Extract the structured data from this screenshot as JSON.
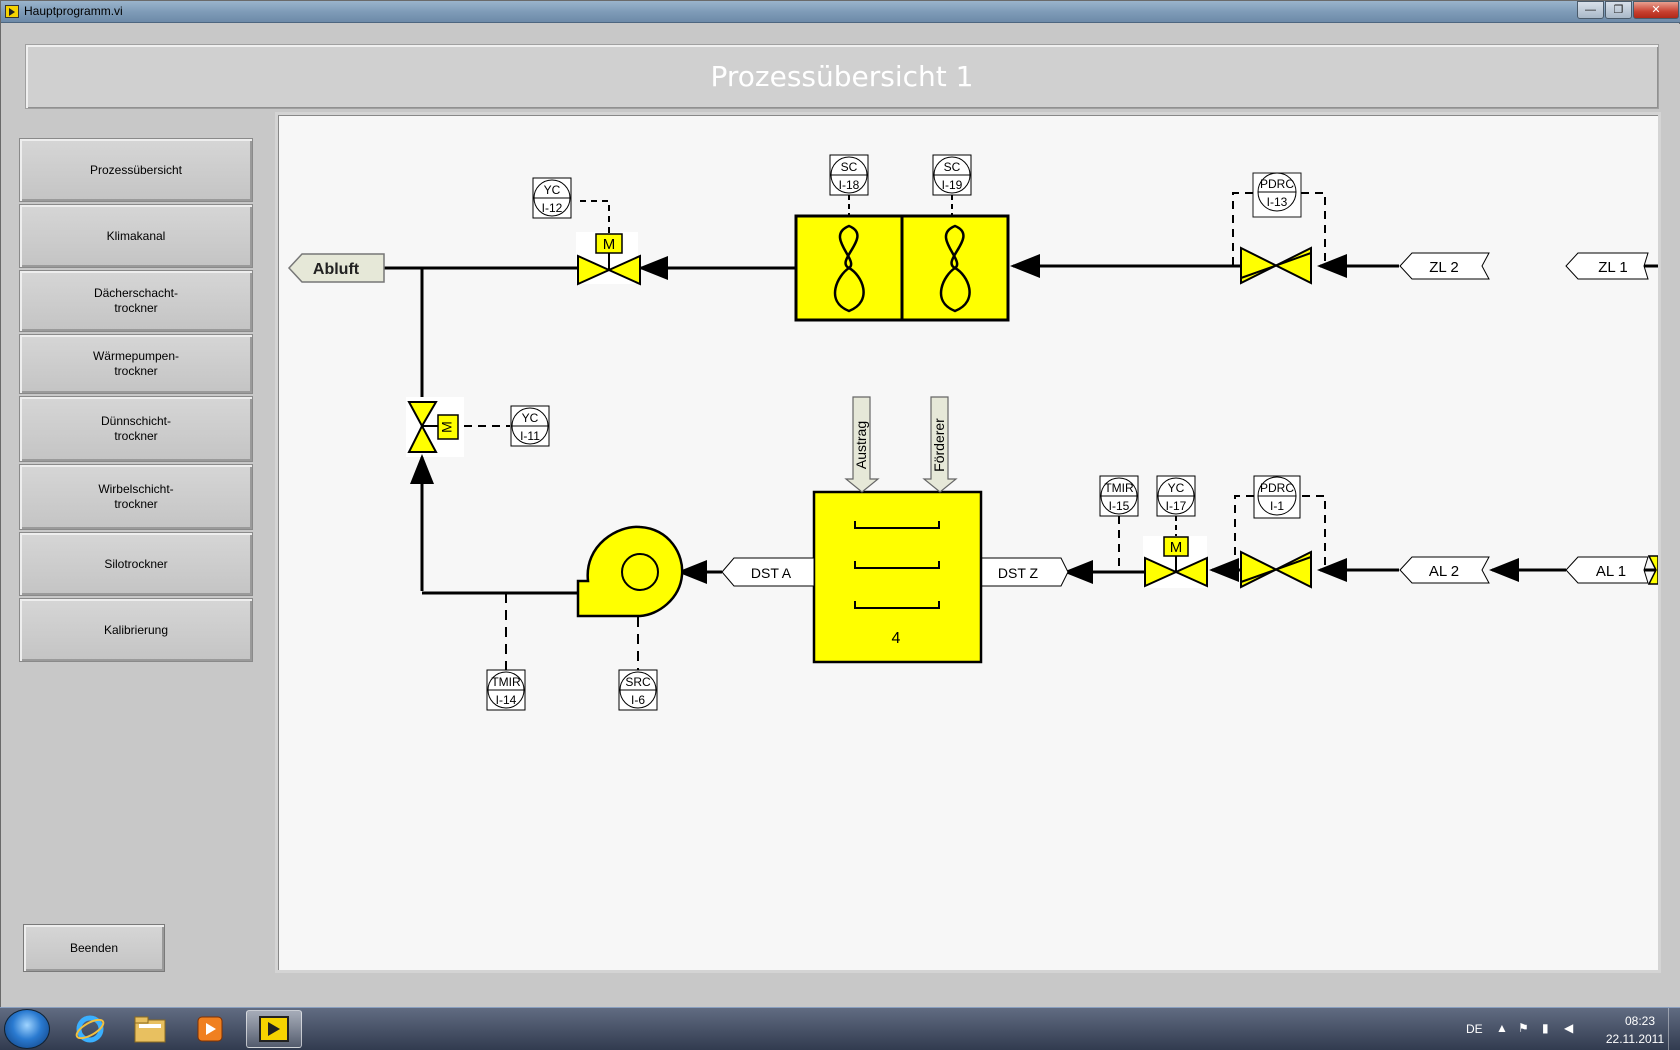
{
  "window": {
    "title": "Hauptprogramm.vi",
    "minimize": "—",
    "maximize": "❐",
    "close": "✕"
  },
  "header": {
    "title": "Prozessübersicht 1"
  },
  "sidebar": {
    "items": [
      {
        "label": "Prozessübersicht"
      },
      {
        "label": "Klimakanal"
      },
      {
        "label": "Dächerschacht-\ntrockner"
      },
      {
        "label": "Wärmepumpen-\ntrockner"
      },
      {
        "label": "Dünnschicht-\ntrockner"
      },
      {
        "label": "Wirbelschicht-\ntrockner"
      },
      {
        "label": "Silotrockner"
      },
      {
        "label": "Kalibrierung"
      }
    ],
    "exit_label": "Beenden"
  },
  "diagram": {
    "colors": {
      "equipment": "#ffff00",
      "line": "#000000",
      "background": "#f7f7f7"
    },
    "connectors": {
      "abluft": "Abluft",
      "zl2": "ZL 2",
      "zl1": "ZL 1",
      "al2": "AL 2",
      "al1": "AL 1",
      "dst_a": "DST A",
      "dst_z": "DST Z"
    },
    "feeds": {
      "austrag": "Austrag",
      "foerderer": "Förderer"
    },
    "dryer_number": "4",
    "motor_label": "M",
    "instruments": [
      {
        "id": "yc-i12",
        "func": "YC",
        "tag": "I-12"
      },
      {
        "id": "sc-i18",
        "func": "SC",
        "tag": "I-18"
      },
      {
        "id": "sc-i19",
        "func": "SC",
        "tag": "I-19"
      },
      {
        "id": "pdrc-i13",
        "func": "PDRC",
        "tag": "I-13"
      },
      {
        "id": "yc-i11",
        "func": "YC",
        "tag": "I-11"
      },
      {
        "id": "tmir-i15",
        "func": "TMIR",
        "tag": "I-15"
      },
      {
        "id": "yc-i17",
        "func": "YC",
        "tag": "I-17"
      },
      {
        "id": "pdrc-i1",
        "func": "PDRC",
        "tag": "I-1"
      },
      {
        "id": "tmir-i14",
        "func": "TMIR",
        "tag": "I-14"
      },
      {
        "id": "src-i6",
        "func": "SRC",
        "tag": "I-6"
      }
    ]
  },
  "taskbar": {
    "language": "DE",
    "time": "08:23",
    "date": "22.11.2011"
  }
}
